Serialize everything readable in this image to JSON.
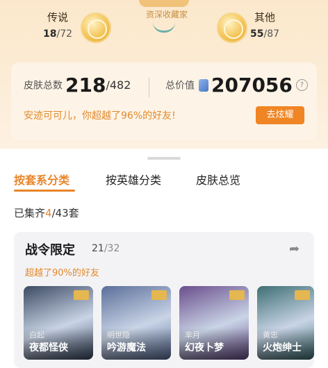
{
  "header": {
    "banner_text": "资深收藏家",
    "legend": {
      "label": "传说",
      "owned": "18",
      "total": "/72"
    },
    "other": {
      "label": "其他",
      "owned": "55",
      "total": "/87"
    }
  },
  "summary": {
    "skins_label": "皮肤总数",
    "skins_owned": "218",
    "skins_total": "/482",
    "value_label": "总价值",
    "value_amount": "207056",
    "help_glyph": "?",
    "beat_text": "安迹可可儿，你超越了96%的好友!",
    "flex_button": "去炫耀"
  },
  "tabs": [
    {
      "label": "按套系分类",
      "active": true
    },
    {
      "label": "按英雄分类",
      "active": false
    },
    {
      "label": "皮肤总览",
      "active": false
    }
  ],
  "collected": {
    "prefix": "已集齐",
    "count": "4",
    "suffix": "/43套"
  },
  "card": {
    "title": "战令限定",
    "owned": "21",
    "total": "/32",
    "subtitle": "超越了90%的好友",
    "share_icon": "share-icon",
    "skins": [
      {
        "hero": "白起",
        "name": "夜都怪侠",
        "color": "#3c4a63"
      },
      {
        "hero": "明世隐",
        "name": "吟游魔法",
        "color": "#5b6f9a"
      },
      {
        "hero": "芈月",
        "name": "幻夜卜梦",
        "color": "#6a4e8c"
      },
      {
        "hero": "黄忠",
        "name": "火炮绅士",
        "color": "#3e6f74"
      }
    ]
  }
}
